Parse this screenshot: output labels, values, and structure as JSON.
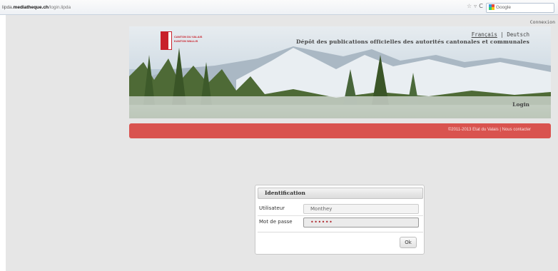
{
  "browser": {
    "url_prefix": "lipda.",
    "url_domain": "mediatheque.ch",
    "url_path": "/login.lipda",
    "search_placeholder": "Google",
    "star_icon": "☆",
    "dropdown_icon": "▿",
    "refresh_icon": "C"
  },
  "header": {
    "connexion": "Connexion",
    "lang_fr": "Français",
    "lang_sep": " | ",
    "lang_de": "Deutsch",
    "title": "Dépôt des publications officielles des autorités cantonales et communales",
    "login": "Login",
    "logo_line1": "CANTON DU VALAIS",
    "logo_line2": "KANTON WALLIS"
  },
  "footer": {
    "copyright": "©2011-2013 Etat du Valais",
    "sep": " | ",
    "contact": "Nous contacter"
  },
  "login_panel": {
    "title": "Identification",
    "user_label": "Utilisateur",
    "user_value": "Monthey",
    "password_label": "Mot de passe",
    "password_value": "••••••",
    "ok_label": "Ok"
  },
  "colors": {
    "accent_red": "#d9534f",
    "canton_red": "#c8202a"
  }
}
